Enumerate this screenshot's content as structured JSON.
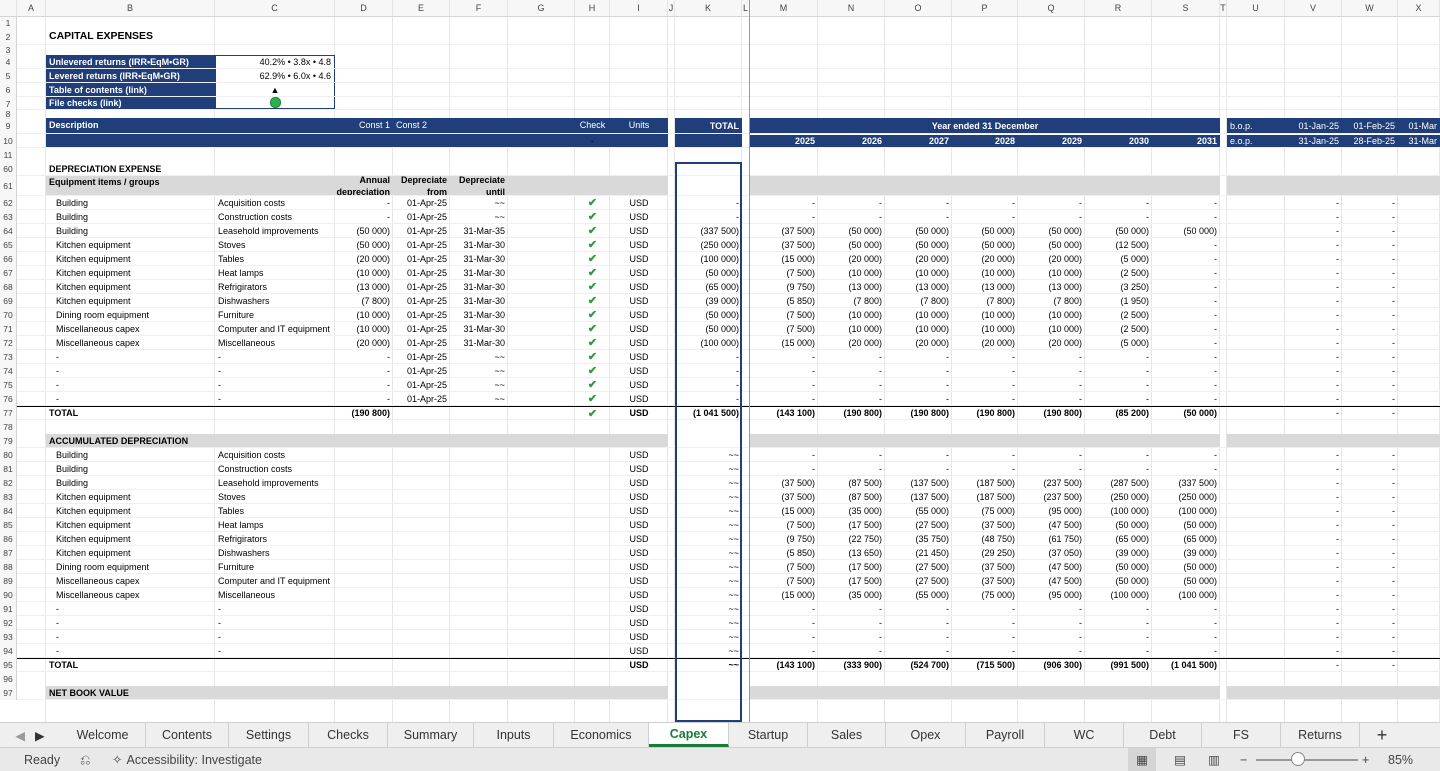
{
  "columns": [
    "A",
    "B",
    "C",
    "D",
    "E",
    "F",
    "G",
    "H",
    "I",
    "J",
    "K",
    "L",
    "M",
    "N",
    "O",
    "P",
    "Q",
    "R",
    "S",
    "T",
    "U",
    "V",
    "W",
    "X"
  ],
  "title": "CAPITAL EXPENSES",
  "summary": [
    {
      "row": "4",
      "label": "Unlevered returns (IRR•EqM•GR)",
      "value": "40.2% • 3.8x • 4.8"
    },
    {
      "row": "5",
      "label": "Levered returns (IRR•EqM•GR)",
      "value": "62.9% • 6.0x • 4.6"
    },
    {
      "row": "6",
      "label": "Table of contents (link)",
      "value": "▲"
    },
    {
      "row": "7",
      "label": "File checks (link)",
      "value": ""
    }
  ],
  "header": {
    "description": "Description",
    "const1": "Const 1",
    "const2": "Const 2",
    "check": "Check",
    "check_value": "-",
    "units": "Units",
    "total": "TOTAL",
    "year_ended": "Year ended 31 December",
    "years": [
      "2025",
      "2026",
      "2027",
      "2028",
      "2029",
      "2030",
      "2031"
    ],
    "bop": "b.o.p.",
    "eop": "e.o.p.",
    "months_start": [
      "01-Jan-25",
      "01-Feb-25",
      "01-Mar"
    ],
    "months_end": [
      "31-Jan-25",
      "28-Feb-25",
      "31-Mar"
    ]
  },
  "dep_section": {
    "title": "DEPRECIATION EXPENSE",
    "subtitle": "Equipment items / groups",
    "col_d": "Annual",
    "col_d2": "depreciation",
    "col_e": "Depreciate",
    "col_e2": "from",
    "col_f": "Depreciate",
    "col_f2": "until",
    "rows": [
      {
        "r": "62",
        "b": "Building",
        "c": "Acquisition costs",
        "d": "-",
        "e": "01-Apr-25",
        "f": "~~",
        "i": "USD",
        "k": "-",
        "y": [
          "-",
          "-",
          "-",
          "-",
          "-",
          "-",
          "-"
        ]
      },
      {
        "r": "63",
        "b": "Building",
        "c": "Construction costs",
        "d": "-",
        "e": "01-Apr-25",
        "f": "~~",
        "i": "USD",
        "k": "-",
        "y": [
          "-",
          "-",
          "-",
          "-",
          "-",
          "-",
          "-"
        ]
      },
      {
        "r": "64",
        "b": "Building",
        "c": "Leasehold improvements",
        "d": "(50 000)",
        "e": "01-Apr-25",
        "f": "31-Mar-35",
        "i": "USD",
        "k": "(337 500)",
        "y": [
          "(37 500)",
          "(50 000)",
          "(50 000)",
          "(50 000)",
          "(50 000)",
          "(50 000)",
          "(50 000)"
        ]
      },
      {
        "r": "65",
        "b": "Kitchen equipment",
        "c": "Stoves",
        "d": "(50 000)",
        "e": "01-Apr-25",
        "f": "31-Mar-30",
        "i": "USD",
        "k": "(250 000)",
        "y": [
          "(37 500)",
          "(50 000)",
          "(50 000)",
          "(50 000)",
          "(50 000)",
          "(12 500)",
          "-"
        ]
      },
      {
        "r": "66",
        "b": "Kitchen equipment",
        "c": "Tables",
        "d": "(20 000)",
        "e": "01-Apr-25",
        "f": "31-Mar-30",
        "i": "USD",
        "k": "(100 000)",
        "y": [
          "(15 000)",
          "(20 000)",
          "(20 000)",
          "(20 000)",
          "(20 000)",
          "(5 000)",
          "-"
        ]
      },
      {
        "r": "67",
        "b": "Kitchen equipment",
        "c": "Heat lamps",
        "d": "(10 000)",
        "e": "01-Apr-25",
        "f": "31-Mar-30",
        "i": "USD",
        "k": "(50 000)",
        "y": [
          "(7 500)",
          "(10 000)",
          "(10 000)",
          "(10 000)",
          "(10 000)",
          "(2 500)",
          "-"
        ]
      },
      {
        "r": "68",
        "b": "Kitchen equipment",
        "c": "Refrigirators",
        "d": "(13 000)",
        "e": "01-Apr-25",
        "f": "31-Mar-30",
        "i": "USD",
        "k": "(65 000)",
        "y": [
          "(9 750)",
          "(13 000)",
          "(13 000)",
          "(13 000)",
          "(13 000)",
          "(3 250)",
          "-"
        ]
      },
      {
        "r": "69",
        "b": "Kitchen equipment",
        "c": "Dishwashers",
        "d": "(7 800)",
        "e": "01-Apr-25",
        "f": "31-Mar-30",
        "i": "USD",
        "k": "(39 000)",
        "y": [
          "(5 850)",
          "(7 800)",
          "(7 800)",
          "(7 800)",
          "(7 800)",
          "(1 950)",
          "-"
        ]
      },
      {
        "r": "70",
        "b": "Dining room equipment",
        "c": "Furniture",
        "d": "(10 000)",
        "e": "01-Apr-25",
        "f": "31-Mar-30",
        "i": "USD",
        "k": "(50 000)",
        "y": [
          "(7 500)",
          "(10 000)",
          "(10 000)",
          "(10 000)",
          "(10 000)",
          "(2 500)",
          "-"
        ]
      },
      {
        "r": "71",
        "b": "Miscellaneous capex",
        "c": "Computer and IT equipment",
        "d": "(10 000)",
        "e": "01-Apr-25",
        "f": "31-Mar-30",
        "i": "USD",
        "k": "(50 000)",
        "y": [
          "(7 500)",
          "(10 000)",
          "(10 000)",
          "(10 000)",
          "(10 000)",
          "(2 500)",
          "-"
        ]
      },
      {
        "r": "72",
        "b": "Miscellaneous capex",
        "c": "Miscellaneous",
        "d": "(20 000)",
        "e": "01-Apr-25",
        "f": "31-Mar-30",
        "i": "USD",
        "k": "(100 000)",
        "y": [
          "(15 000)",
          "(20 000)",
          "(20 000)",
          "(20 000)",
          "(20 000)",
          "(5 000)",
          "-"
        ]
      },
      {
        "r": "73",
        "b": "-",
        "c": "-",
        "d": "-",
        "e": "01-Apr-25",
        "f": "~~",
        "i": "USD",
        "k": "-",
        "y": [
          "-",
          "-",
          "-",
          "-",
          "-",
          "-",
          "-"
        ]
      },
      {
        "r": "74",
        "b": "-",
        "c": "-",
        "d": "-",
        "e": "01-Apr-25",
        "f": "~~",
        "i": "USD",
        "k": "-",
        "y": [
          "-",
          "-",
          "-",
          "-",
          "-",
          "-",
          "-"
        ]
      },
      {
        "r": "75",
        "b": "-",
        "c": "-",
        "d": "-",
        "e": "01-Apr-25",
        "f": "~~",
        "i": "USD",
        "k": "-",
        "y": [
          "-",
          "-",
          "-",
          "-",
          "-",
          "-",
          "-"
        ]
      },
      {
        "r": "76",
        "b": "-",
        "c": "-",
        "d": "-",
        "e": "01-Apr-25",
        "f": "~~",
        "i": "USD",
        "k": "-",
        "y": [
          "-",
          "-",
          "-",
          "-",
          "-",
          "-",
          "-"
        ]
      }
    ],
    "total": {
      "r": "77",
      "b": "TOTAL",
      "d": "(190 800)",
      "i": "USD",
      "k": "(1 041 500)",
      "y": [
        "(143 100)",
        "(190 800)",
        "(190 800)",
        "(190 800)",
        "(190 800)",
        "(85 200)",
        "(50 000)"
      ]
    }
  },
  "acc_section": {
    "title": "ACCUMULATED DEPRECIATION",
    "rows": [
      {
        "r": "80",
        "b": "Building",
        "c": "Acquisition costs",
        "i": "USD",
        "k": "~~",
        "y": [
          "-",
          "-",
          "-",
          "-",
          "-",
          "-",
          "-"
        ]
      },
      {
        "r": "81",
        "b": "Building",
        "c": "Construction costs",
        "i": "USD",
        "k": "~~",
        "y": [
          "-",
          "-",
          "-",
          "-",
          "-",
          "-",
          "-"
        ]
      },
      {
        "r": "82",
        "b": "Building",
        "c": "Leasehold improvements",
        "i": "USD",
        "k": "~~",
        "y": [
          "(37 500)",
          "(87 500)",
          "(137 500)",
          "(187 500)",
          "(237 500)",
          "(287 500)",
          "(337 500)"
        ]
      },
      {
        "r": "83",
        "b": "Kitchen equipment",
        "c": "Stoves",
        "i": "USD",
        "k": "~~",
        "y": [
          "(37 500)",
          "(87 500)",
          "(137 500)",
          "(187 500)",
          "(237 500)",
          "(250 000)",
          "(250 000)"
        ]
      },
      {
        "r": "84",
        "b": "Kitchen equipment",
        "c": "Tables",
        "i": "USD",
        "k": "~~",
        "y": [
          "(15 000)",
          "(35 000)",
          "(55 000)",
          "(75 000)",
          "(95 000)",
          "(100 000)",
          "(100 000)"
        ]
      },
      {
        "r": "85",
        "b": "Kitchen equipment",
        "c": "Heat lamps",
        "i": "USD",
        "k": "~~",
        "y": [
          "(7 500)",
          "(17 500)",
          "(27 500)",
          "(37 500)",
          "(47 500)",
          "(50 000)",
          "(50 000)"
        ]
      },
      {
        "r": "86",
        "b": "Kitchen equipment",
        "c": "Refrigirators",
        "i": "USD",
        "k": "~~",
        "y": [
          "(9 750)",
          "(22 750)",
          "(35 750)",
          "(48 750)",
          "(61 750)",
          "(65 000)",
          "(65 000)"
        ]
      },
      {
        "r": "87",
        "b": "Kitchen equipment",
        "c": "Dishwashers",
        "i": "USD",
        "k": "~~",
        "y": [
          "(5 850)",
          "(13 650)",
          "(21 450)",
          "(29 250)",
          "(37 050)",
          "(39 000)",
          "(39 000)"
        ]
      },
      {
        "r": "88",
        "b": "Dining room equipment",
        "c": "Furniture",
        "i": "USD",
        "k": "~~",
        "y": [
          "(7 500)",
          "(17 500)",
          "(27 500)",
          "(37 500)",
          "(47 500)",
          "(50 000)",
          "(50 000)"
        ]
      },
      {
        "r": "89",
        "b": "Miscellaneous capex",
        "c": "Computer and IT equipment",
        "i": "USD",
        "k": "~~",
        "y": [
          "(7 500)",
          "(17 500)",
          "(27 500)",
          "(37 500)",
          "(47 500)",
          "(50 000)",
          "(50 000)"
        ]
      },
      {
        "r": "90",
        "b": "Miscellaneous capex",
        "c": "Miscellaneous",
        "i": "USD",
        "k": "~~",
        "y": [
          "(15 000)",
          "(35 000)",
          "(55 000)",
          "(75 000)",
          "(95 000)",
          "(100 000)",
          "(100 000)"
        ]
      },
      {
        "r": "91",
        "b": "-",
        "c": "-",
        "i": "USD",
        "k": "~~",
        "y": [
          "-",
          "-",
          "-",
          "-",
          "-",
          "-",
          "-"
        ]
      },
      {
        "r": "92",
        "b": "-",
        "c": "-",
        "i": "USD",
        "k": "~~",
        "y": [
          "-",
          "-",
          "-",
          "-",
          "-",
          "-",
          "-"
        ]
      },
      {
        "r": "93",
        "b": "-",
        "c": "-",
        "i": "USD",
        "k": "~~",
        "y": [
          "-",
          "-",
          "-",
          "-",
          "-",
          "-",
          "-"
        ]
      },
      {
        "r": "94",
        "b": "-",
        "c": "-",
        "i": "USD",
        "k": "~~",
        "y": [
          "-",
          "-",
          "-",
          "-",
          "-",
          "-",
          "-"
        ]
      }
    ],
    "total": {
      "r": "95",
      "b": "TOTAL",
      "i": "USD",
      "k": "~~",
      "y": [
        "(143 100)",
        "(333 900)",
        "(524 700)",
        "(715 500)",
        "(906 300)",
        "(991 500)",
        "(1 041 500)"
      ]
    }
  },
  "nbv_title": "NET BOOK VALUE",
  "sheet_tabs": [
    "Welcome",
    "Contents",
    "Settings",
    "Checks",
    "Summary",
    "Inputs",
    "Economics",
    "Capex",
    "Startup",
    "Sales",
    "Opex",
    "Payroll",
    "WC",
    "Debt",
    "FS",
    "Returns"
  ],
  "active_tab": "Capex",
  "status": {
    "ready": "Ready",
    "accessibility": "Accessibility: Investigate",
    "zoom": "85%"
  },
  "colors": {
    "navy": "#1f3e7a",
    "check_green": "#2a9d3a",
    "active_tab": "#1a7a37",
    "check_cell": "#a9ecb8"
  }
}
